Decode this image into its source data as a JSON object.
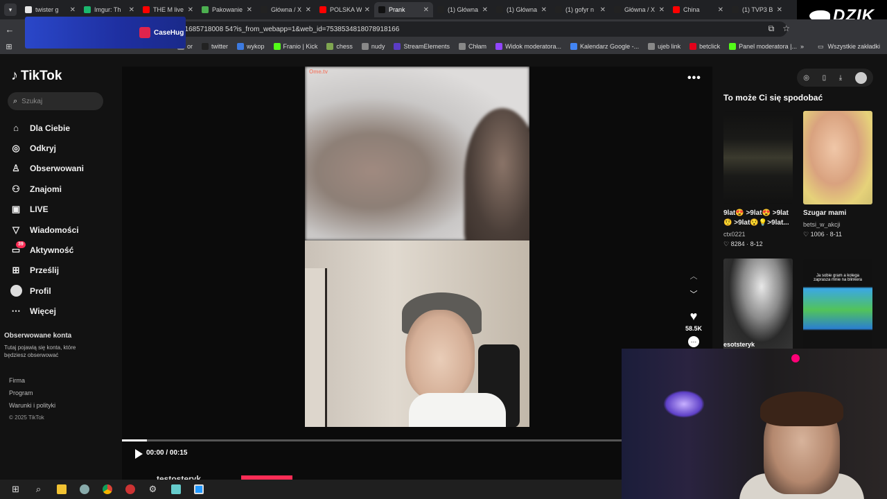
{
  "browser": {
    "tabs": [
      {
        "title": "twister g",
        "color": "#e6e6e6",
        "active": false
      },
      {
        "title": "Imgur: Th",
        "color": "#1bb76e",
        "active": false
      },
      {
        "title": "THE M live",
        "color": "#ff0000",
        "active": false
      },
      {
        "title": "Pakowanie",
        "color": "#4caf50",
        "active": false
      },
      {
        "title": "Główna / X",
        "color": "#222222",
        "active": false
      },
      {
        "title": "POLSKA W",
        "color": "#ff0000",
        "active": false
      },
      {
        "title": "Prank",
        "color": "#111111",
        "active": true
      },
      {
        "title": "(1) Główna",
        "color": "#222222",
        "active": false
      },
      {
        "title": "(1) Główna",
        "color": "#222222",
        "active": false
      },
      {
        "title": "(1) gofyr n",
        "color": "#222222",
        "active": false
      },
      {
        "title": "Główna / X",
        "color": "#222222",
        "active": false
      },
      {
        "title": "China",
        "color": "#ff0000",
        "active": false
      },
      {
        "title": "(1) TVP3 B",
        "color": "#222222",
        "active": false
      }
    ],
    "url": "51685718008 54?is_from_webapp=1&web_id=7538534818078918166",
    "banner_text": "CaseHug",
    "bookmarks": [
      {
        "label": "or",
        "color": "#888888"
      },
      {
        "label": "twitter",
        "color": "#222222"
      },
      {
        "label": "wykop",
        "color": "#3c7ae0"
      },
      {
        "label": "Franio | Kick",
        "color": "#53fc18"
      },
      {
        "label": "chess",
        "color": "#7fa650"
      },
      {
        "label": "nudy",
        "color": "#888888"
      },
      {
        "label": "StreamElements",
        "color": "#5b3cc4"
      },
      {
        "label": "Chłam",
        "color": "#888888"
      },
      {
        "label": "Widok moderatora...",
        "color": "#9146ff"
      },
      {
        "label": "Kalendarz Google -...",
        "color": "#4285f4"
      },
      {
        "label": "ujeb link",
        "color": "#888888"
      },
      {
        "label": "betclick",
        "color": "#e2001a"
      },
      {
        "label": "Panel moderatora |...",
        "color": "#53fc18"
      }
    ],
    "bookmarks_all": "Wszystkie zakładki"
  },
  "overlay": {
    "brand": "DZIK"
  },
  "tiktok": {
    "logo": "TikTok",
    "search_placeholder": "Szukaj",
    "nav": [
      {
        "label": "Dla Ciebie",
        "icon": "home-icon",
        "glyph": "⌂"
      },
      {
        "label": "Odkryj",
        "icon": "compass-icon",
        "glyph": "◎"
      },
      {
        "label": "Obserwowani",
        "icon": "user-plus-icon",
        "glyph": "♙"
      },
      {
        "label": "Znajomi",
        "icon": "friends-icon",
        "glyph": "⚇"
      },
      {
        "label": "LIVE",
        "icon": "live-icon",
        "glyph": "▣"
      },
      {
        "label": "Wiadomości",
        "icon": "send-icon",
        "glyph": "▽"
      },
      {
        "label": "Aktywność",
        "icon": "inbox-icon",
        "glyph": "▭",
        "badge": "39"
      },
      {
        "label": "Prześlij",
        "icon": "upload-icon",
        "glyph": "⊞"
      },
      {
        "label": "Profil",
        "icon": "avatar",
        "glyph": ""
      },
      {
        "label": "Więcej",
        "icon": "more-icon",
        "glyph": "⋯"
      }
    ],
    "followed_title": "Obserwowane konta",
    "followed_desc": "Tutaj pojawią się konta, które będziesz obserwować",
    "footer": [
      "Firma",
      "Program",
      "Warunki i polityki"
    ],
    "copyright": "© 2025 TikTok",
    "video": {
      "watermark": "Ome.tv",
      "time": "00:00 / 00:15",
      "progress": 0.05,
      "author": "testosteryk",
      "likes": "58.5K"
    },
    "recommend_title": "To może Ci się spodobać",
    "cards": [
      {
        "title": "9lat😍 >9lat😍 >9lat 🤨 >9lat😯💡>9lat...",
        "user": "ctx0221",
        "likes": "8284",
        "date": "8-12"
      },
      {
        "title": "Szugar mami",
        "user": "betsi_w_akcji",
        "likes": "1006",
        "date": "8-11"
      }
    ],
    "card3_label": "esotsteryk",
    "card4_caption": "Ja sobie gram a kolega zaprasza mnie na blinkera"
  }
}
